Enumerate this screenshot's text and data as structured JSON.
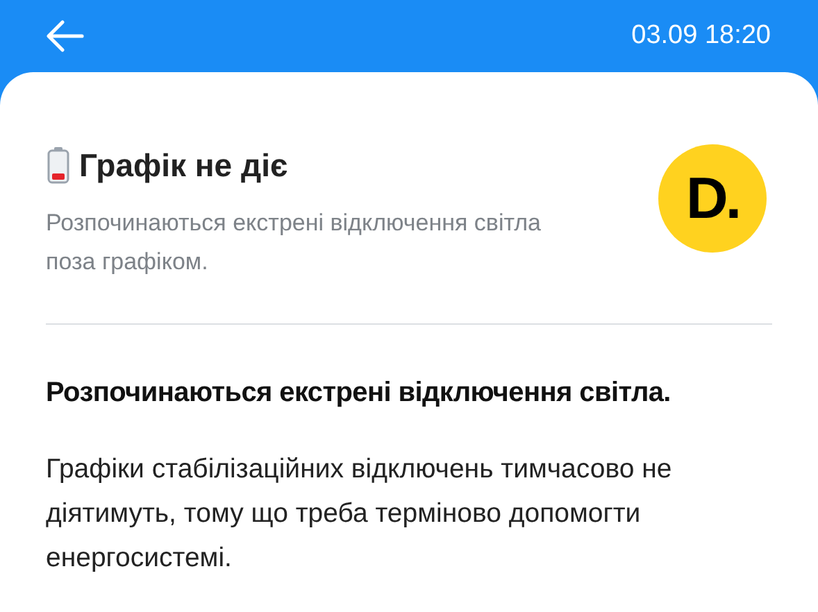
{
  "header": {
    "time": "03.09 18:20"
  },
  "notice": {
    "title": "Графік не діє",
    "subtitle": "Розпочинаються екстрені відключення світла поза графіком.",
    "logo": "D."
  },
  "article": {
    "heading": "Розпочинаються екстрені відключення світла.",
    "body": "Графіки стабілізаційних відключень тимчасово не діятимуть, тому що треба терміново допомогти енергосистемі."
  }
}
